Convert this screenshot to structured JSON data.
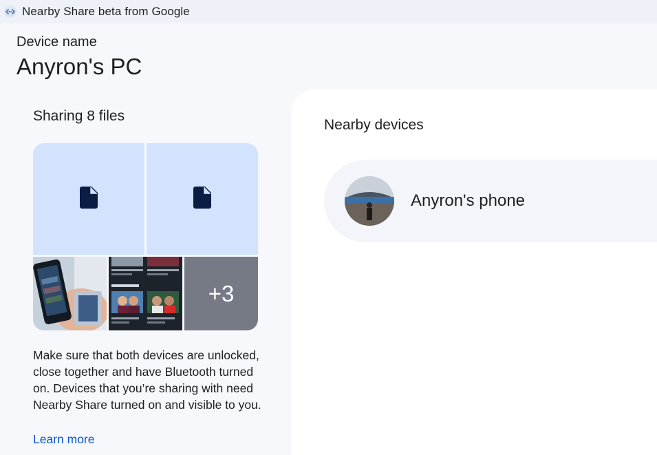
{
  "window": {
    "title": "Nearby Share beta from Google",
    "icon": "nearby-share-icon"
  },
  "device": {
    "label": "Device name",
    "name": "Anyron's PC"
  },
  "sharing": {
    "title": "Sharing 8 files",
    "more_count": "+3",
    "help_text": "Make sure that both devices are unlocked, close together and have Bluetooth turned on. Devices that you’re sharing with need Nearby Share turned on and visible to you.",
    "learn_more": "Learn more"
  },
  "nearby": {
    "title": "Nearby devices",
    "devices": [
      {
        "name": "Anyron's phone",
        "avatar": "stadium-photo-avatar"
      }
    ]
  },
  "colors": {
    "background": "#f6f8fc",
    "file_tile": "#d3e3fd",
    "file_icon": "#0b1d44",
    "more_tile": "#757a85",
    "link": "#0b57d0"
  }
}
